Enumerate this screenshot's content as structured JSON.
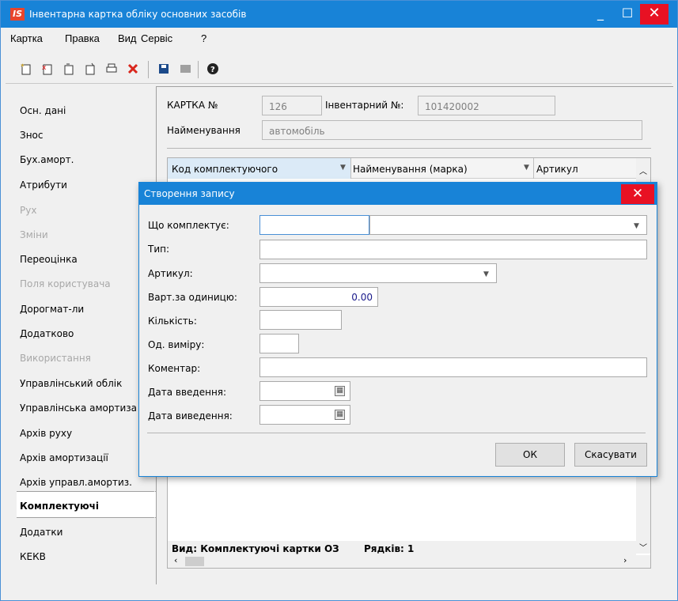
{
  "window": {
    "logo_text": "IS",
    "title": "Інвентарна картка обліку основних засобів",
    "minimize": "_",
    "maximize": "☐",
    "close": "✕"
  },
  "menu": [
    "Картка",
    "Правка",
    "Вид",
    "Сервіс",
    "?"
  ],
  "toolbar_icons": [
    "new-doc-icon",
    "delete-doc-icon",
    "copy-icon",
    "paste-icon",
    "print-icon",
    "delete-icon",
    "save-icon",
    "disabled-icon",
    "help-icon"
  ],
  "nav": {
    "items": [
      {
        "label": "Осн. дані",
        "state": "normal"
      },
      {
        "label": "Знос",
        "state": "normal"
      },
      {
        "label": "Бух.аморт.",
        "state": "normal"
      },
      {
        "label": "Атрибути",
        "state": "normal"
      },
      {
        "label": "Рух",
        "state": "disabled"
      },
      {
        "label": "Зміни",
        "state": "disabled"
      },
      {
        "label": "Переоцінка",
        "state": "normal"
      },
      {
        "label": "Поля користувача",
        "state": "disabled"
      },
      {
        "label": "Дорогмат-ли",
        "state": "normal"
      },
      {
        "label": "Додатково",
        "state": "normal"
      },
      {
        "label": "Використання",
        "state": "disabled"
      },
      {
        "label": "Управлінський облік",
        "state": "normal"
      },
      {
        "label": "Управлінська амортиза",
        "state": "normal"
      },
      {
        "label": "Архів руху",
        "state": "normal"
      },
      {
        "label": "Архів амортизації",
        "state": "normal"
      },
      {
        "label": "Архів управл.амортиз.",
        "state": "normal"
      },
      {
        "label": "Комплектуючі",
        "state": "active"
      },
      {
        "label": "Додатки",
        "state": "normal"
      },
      {
        "label": "КЕКВ",
        "state": "normal"
      }
    ]
  },
  "card": {
    "card_no_label": "КАРТКА №",
    "card_no": "126",
    "inv_no_label": "Інвентарний №:",
    "inv_no": "101420002",
    "name_label": "Найменування",
    "name": "автомобіль"
  },
  "grid": {
    "columns": [
      "Код комплектуючого",
      "Найменування (марка)",
      "Артикул"
    ],
    "status_view": "Вид: Комплектуючі картки ОЗ",
    "status_rows": "Рядків: 1"
  },
  "dialog": {
    "title": "Створення запису",
    "close": "✕",
    "fields": {
      "what_label": "Що комплектує:",
      "type_label": "Тип:",
      "article_label": "Артикул:",
      "unit_cost_label": "Варт.за одиницю:",
      "unit_cost_value": "0.00",
      "qty_label": "Кількість:",
      "uom_label": "Од. виміру:",
      "comment_label": "Коментар:",
      "date_in_label": "Дата введення:",
      "date_out_label": "Дата виведення:"
    },
    "ok": "ОК",
    "cancel": "Скасувати"
  }
}
